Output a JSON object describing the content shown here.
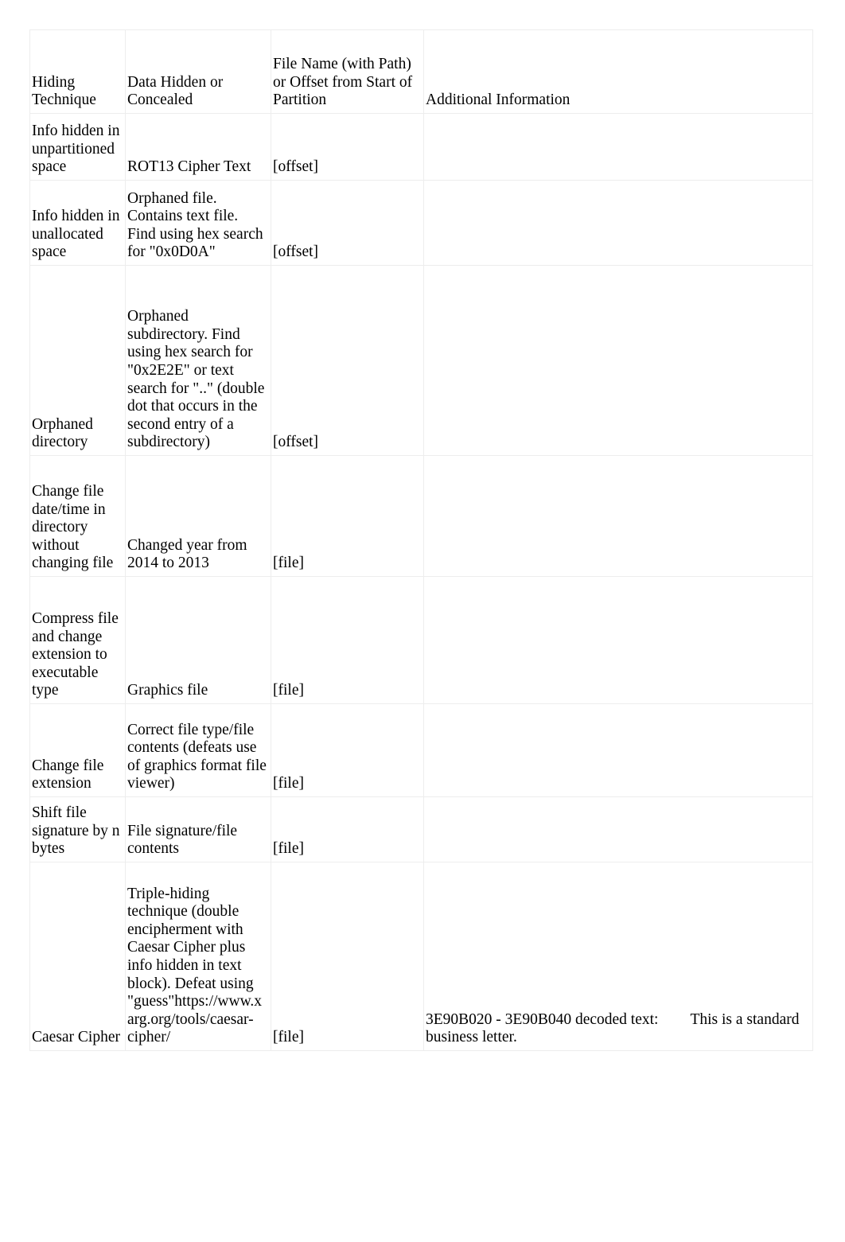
{
  "table": {
    "headers": [
      " Hiding Technique",
      "Data Hidden or Concealed",
      "File Name (with Path) or Offset from Start of Partition",
      "Additional Information"
    ],
    "rows": [
      {
        "technique": "Info hidden in unpartitioned space",
        "data_hidden": "ROT13 Cipher Text",
        "file_or_offset": "[offset]",
        "additional": ""
      },
      {
        "technique": "Info hidden in unallocated space",
        "data_hidden": "Orphaned file. Contains text file. Find using hex search for \"0x0D0A\"",
        "file_or_offset": "[offset]",
        "additional": ""
      },
      {
        "technique": "Orphaned directory",
        "data_hidden": "Orphaned subdirectory. Find using hex search for \"0x2E2E\" or text search for \"..\" (double dot that occurs in the second entry of a subdirectory)",
        "file_or_offset": "[offset]",
        "additional": ""
      },
      {
        "technique": "Change file date/time in directory without changing file",
        "data_hidden": "Changed year from 2014 to 2013",
        "file_or_offset": "[file]",
        "additional": ""
      },
      {
        "technique": "Compress file and change extension to executable type",
        "data_hidden": "Graphics file",
        "file_or_offset": "[file]",
        "additional": ""
      },
      {
        "technique": "Change file extension",
        "data_hidden": "Correct file type/file contents (defeats use of graphics format file viewer)",
        "file_or_offset": "[file]",
        "additional": ""
      },
      {
        "technique": "Shift file signature by n bytes",
        "data_hidden": "File signature/file contents",
        "file_or_offset": "[file]",
        "additional": ""
      },
      {
        "technique": "Caesar Cipher",
        "data_hidden": "Triple-hiding technique (double encipherment with Caesar Cipher plus info hidden in text block). Defeat using \"guess\"https://www.xarg.org/tools/caesar-cipher/",
        "file_or_offset": "[file]",
        "additional_part1": "3E90B020 - 3E90B040 decoded text:",
        "additional_part2": "This is a standard business letter."
      }
    ]
  }
}
